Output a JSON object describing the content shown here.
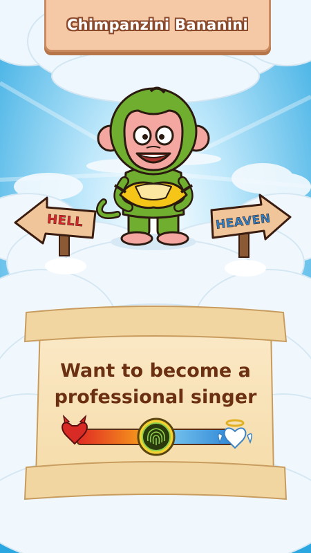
{
  "title": "Chimpanzini Bananini",
  "signs": {
    "left": "HELL",
    "right": "HEAVEN"
  },
  "question": {
    "line1": "Want to become a",
    "line2": "professional singer"
  },
  "slider": {
    "left_icon": "devil-heart-icon",
    "right_icon": "angel-heart-icon",
    "handle_icon": "fingerprint-icon",
    "value": 0.5
  },
  "colors": {
    "hell": "#d8262b",
    "heaven": "#2f7fc7",
    "text_brown": "#6b2f12",
    "monkey_green": "#6fae2e",
    "banana_yellow": "#f5c518"
  }
}
